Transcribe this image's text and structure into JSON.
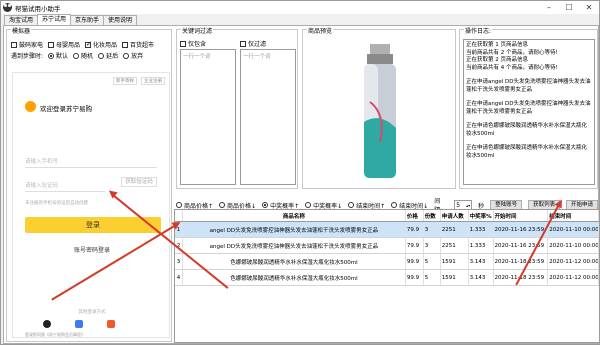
{
  "window": {
    "title": "帮猫试用小助手"
  },
  "tabs": [
    "淘宝试用",
    "苏宁试用",
    "京东助手",
    "使用说明"
  ],
  "simulator": {
    "legend": "模拟器",
    "checks": [
      {
        "label": "鼓码家电",
        "checked": false
      },
      {
        "label": "母婴用品",
        "checked": false
      },
      {
        "label": "化妆用品",
        "checked": true
      },
      {
        "label": "百货超市",
        "checked": false
      }
    ],
    "step_label": "遇到步骤时:",
    "radios": [
      {
        "label": "默认",
        "on": true
      },
      {
        "label": "随机",
        "on": false
      },
      {
        "label": "延后",
        "on": false
      },
      {
        "label": "放弃",
        "on": false
      }
    ],
    "login": {
      "top_links": [
        "新手寄样",
        "企业注册"
      ],
      "welcome": "欢迎登录苏宁易购",
      "phone_placeholder": "请输入手机号",
      "code_placeholder": "请输入验证码",
      "get_code": "获取验证码",
      "hint": "未注册的手机号验证后自动创建",
      "login_button": "登录",
      "password_login": "账号密码登录",
      "other_methods": "其他登录方式",
      "agreement": "登录即同意《苏宁易购会员章程》"
    }
  },
  "keywords": {
    "legend": "关键词过滤",
    "only_include": "仅包含",
    "only_filter": "仅过滤",
    "placeholder": "一行一个词"
  },
  "image_preview": {
    "legend": "商品预览"
  },
  "log": {
    "legend": "操作日志:",
    "lines": [
      "正在获取第 1 页商品信息\n当前商品共有 2 个商品，请耐心等待!\n正在获取第 2 页商品信息\n当前商品共有 4 个商品，请耐心等待!",
      "正在申请angel DD头发免洗喷雾控油神器头发去油蓬松干洗头发喷雾男女正品",
      "正在申请angel DD头发免洗喷雾控油神器头发去油蓬松干洗头发喷雾男女正品",
      "正在申请色娜娜玻尿酸润透精华水补水保湿大瓶化妆水500ml",
      "正在申请色娜娜玻尿酸润透精华水补水保湿大瓶化妆水500ml"
    ]
  },
  "sort": {
    "options": [
      "商品价格↑",
      "商品价格↓",
      "中奖概率↑",
      "中奖概率↓",
      "结束时间↑",
      "结束时间↓"
    ],
    "selected_index": 2,
    "interval_label": "间隔:",
    "interval_value": "5",
    "interval_unit": "秒",
    "buttons": [
      "登陆账号",
      "获取列表",
      "开始申请"
    ]
  },
  "table": {
    "headers": [
      "",
      "商品名称",
      "价格",
      "份数",
      "申请人数",
      "中奖率%",
      "开始时间",
      "结束时间"
    ],
    "rows": [
      [
        "1",
        "angel DD头发免洗喷雾控油神器头发去油蓬松干洗头发喷雾男女正品",
        "79.9",
        "3",
        "2251",
        "1.333",
        "2020-11-16 23:59",
        "2020-11-10 00:00"
      ],
      [
        "2",
        "angel DD头发免洗喷雾控油神器头发去油蓬松干洗头发喷雾男女正品",
        "79.9",
        "3",
        "2251",
        "1.333",
        "2020-11-16 23:59",
        "2020-11-10 00:00"
      ],
      [
        "3",
        "色娜娜玻尿酸润透精华水补水保湿大瓶化妆水500ml",
        "99.9",
        "5",
        "1591",
        "3.143",
        "2020-11-18 23:59",
        "2020-11-12 00:00"
      ],
      [
        "4",
        "色娜娜玻尿酸润透精华水补水保湿大瓶化妆水500ml",
        "99.9",
        "5",
        "1591",
        "3.143",
        "2020-11-18 23:59",
        "2020-11-12 00:00"
      ]
    ],
    "selected_row": 0
  },
  "colors": {
    "accent_yellow": "#fbcf2f",
    "selection": "#cde3f7",
    "arrow": "#d23a2a"
  }
}
